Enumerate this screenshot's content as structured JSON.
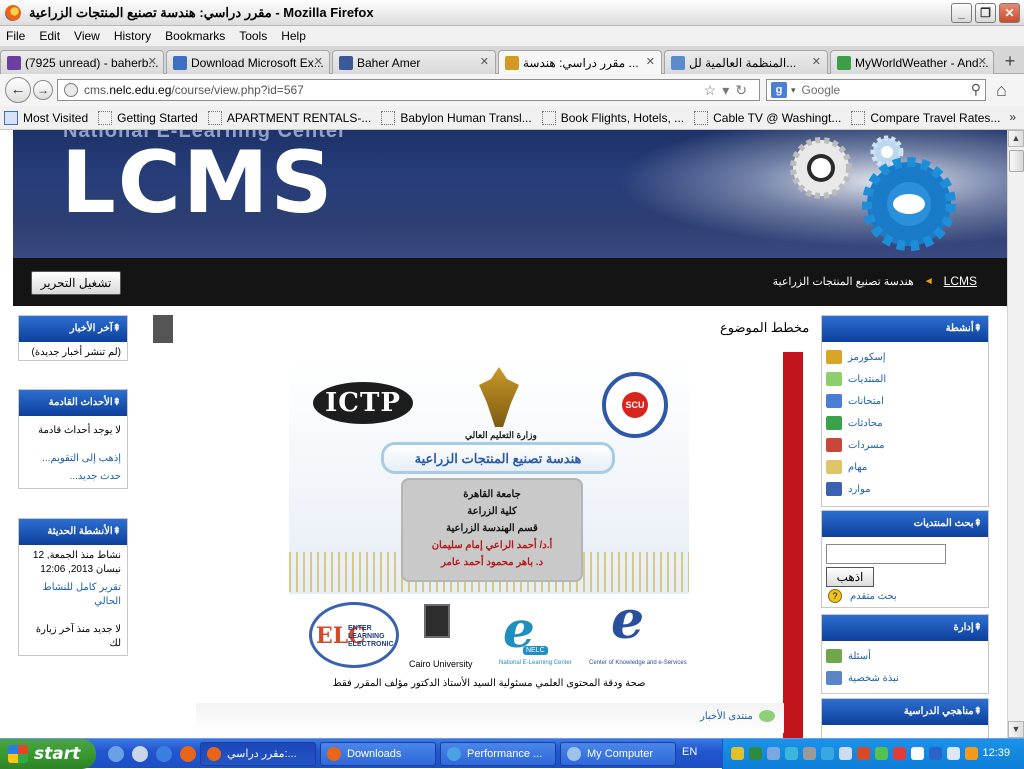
{
  "window": {
    "title": "مقرر دراسي: هندسة تصنيع المنتجات الزراعية - Mozilla Firefox",
    "controls": {
      "minimize": "_",
      "restore": "❐",
      "close": "✕"
    }
  },
  "menu": [
    "File",
    "Edit",
    "View",
    "History",
    "Bookmarks",
    "Tools",
    "Help"
  ],
  "tabs": [
    {
      "label": "(7925 unread) - baherb...",
      "icon": "mail-icon",
      "color": "#6b3fa0"
    },
    {
      "label": "Download Microsoft Ex...",
      "icon": "microsoft-icon",
      "color": "#3a6fc4"
    },
    {
      "label": "Baher Amer",
      "icon": "facebook-icon",
      "color": "#3b5998"
    },
    {
      "label": "مقرر دراسي: هندسة ...",
      "icon": "lcms-icon",
      "color": "#d29a25",
      "active": true
    },
    {
      "label": "المنظمة العالمية لل...",
      "icon": "un-icon",
      "color": "#5b8cc9"
    },
    {
      "label": "MyWorldWeather - And...",
      "icon": "weather-icon",
      "color": "#3d9e49"
    }
  ],
  "nav": {
    "url_prefix": "cms.",
    "url_host": "nelc.edu.eg",
    "url_path": "/course/view.php?id=567",
    "search_engine": "Google",
    "search_placeholder": "Google"
  },
  "bookmarks": [
    "Most Visited",
    "Getting Started",
    "APARTMENT RENTALS-...",
    "Babylon Human Transl...",
    "Book Flights, Hotels, ...",
    "Cable TV @ Washingt...",
    "Compare Travel Rates..."
  ],
  "banner": {
    "top_text": "National E-Learning Center",
    "logo": "LCMS"
  },
  "breadcrumb": {
    "home": "LCMS",
    "separator": "◄",
    "course": "هندسة تصنيع المنتجات الزراعية",
    "edit_button": "تشغيل التحرير"
  },
  "left_blocks": {
    "news": {
      "title": "آخر الأخبار",
      "body": "(لم تنشر أخبار جديدة)"
    },
    "events": {
      "title": "الأحداث القادمة",
      "body": "لا يوجد أحداث قادمة",
      "link1": "إذهب إلى التقويم...",
      "link2": "حدث جديد..."
    },
    "activity": {
      "title": "الأنشطة الحديثة",
      "body": "نشاط منذ الجمعة, 12 نيسان 2013, 12:06",
      "link": "تقرير كامل للنشاط الحالي",
      "note": "لا جديد منذ آخر زيارة لك"
    }
  },
  "center": {
    "title": "مخطط الموضوع",
    "poster": {
      "ictp": "ICTP",
      "ministry": "وزارة التعليم العالي",
      "scu": "SCU",
      "course_banner": "هندسة تصنيع المنتجات الزراعية",
      "lines": [
        "جامعة القاهرة",
        "كلية الزراعة",
        "قسم الهندسة الزراعية"
      ],
      "authors": [
        "أ.د/ أحمد الراعي إمام سليمان",
        "د. باهر محمود أحمد عامر"
      ],
      "elc": "ELC",
      "elc_sub": "ENTER LEARNING ELECTRONIC",
      "cairo": "Cairo University",
      "nelc_badge": "NELC",
      "nelc_sub": "National E-Learning Center",
      "ck_sub": "Center of Knowledge and e-Services"
    },
    "disclaimer": "صحة ودقة المحتوى العلمي مسئولية السيد الأستاذ الدكتور مؤلف المقرر فقط",
    "news_forum": "منتدى الأخبار"
  },
  "right_blocks": {
    "activities": {
      "title": "أنشطة",
      "items": [
        {
          "label": "إسكورمز",
          "icon": "scorm-icon",
          "color": "#d9a528"
        },
        {
          "label": "المنتديات",
          "icon": "forum-icon",
          "color": "#8ccf6c"
        },
        {
          "label": "امتحانات",
          "icon": "quiz-icon",
          "color": "#4a7ed4"
        },
        {
          "label": "محادثات",
          "icon": "chat-icon",
          "color": "#3aa34a"
        },
        {
          "label": "مسردات",
          "icon": "glossary-icon",
          "color": "#c9473a"
        },
        {
          "label": "مهام",
          "icon": "assignment-icon",
          "color": "#e0c46a"
        },
        {
          "label": "موارد",
          "icon": "resource-icon",
          "color": "#3a62b0"
        }
      ]
    },
    "search": {
      "title": "بحث المنتديات",
      "button": "اذهب",
      "advanced": "بحث متقدم"
    },
    "admin": {
      "title": "إدارة",
      "items": [
        {
          "label": "أسئلة",
          "icon": "questions-icon",
          "color": "#6fa84a"
        },
        {
          "label": "نبذة شخصية",
          "icon": "profile-icon",
          "color": "#5b86c6"
        }
      ]
    },
    "courses": {
      "title": "مناهجي الدراسية"
    }
  },
  "taskbar": {
    "start": "start",
    "tasks": [
      {
        "label": "مقرر دراسي:...",
        "icon": "firefox-icon",
        "color": "#e8651a",
        "active": true
      },
      {
        "label": "Downloads",
        "icon": "firefox-icon",
        "color": "#e8651a"
      },
      {
        "label": "Performance ...",
        "icon": "performance-icon",
        "color": "#4aa3e0"
      },
      {
        "label": "My Computer",
        "icon": "computer-icon",
        "color": "#9fc2ea"
      }
    ],
    "lang": "EN",
    "clock": "12:39"
  }
}
